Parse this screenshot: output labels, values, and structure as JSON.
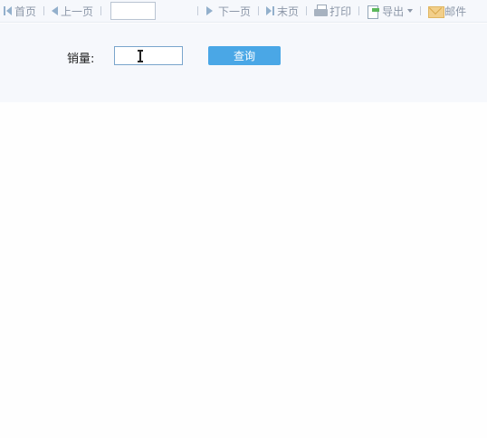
{
  "toolbar": {
    "first_label": "首页",
    "prev_label": "上一页",
    "page_value": "",
    "next_label": "下一页",
    "last_label": "末页",
    "print_label": "打印",
    "export_label": "导出",
    "mail_label": "邮件"
  },
  "query": {
    "field_label": "销量:",
    "field_value": "",
    "submit_label": "查询"
  },
  "colors": {
    "toolbar_bg": "#f6f8fc",
    "button_bg": "#4aa7e6",
    "page_bg": "#fefefe"
  }
}
